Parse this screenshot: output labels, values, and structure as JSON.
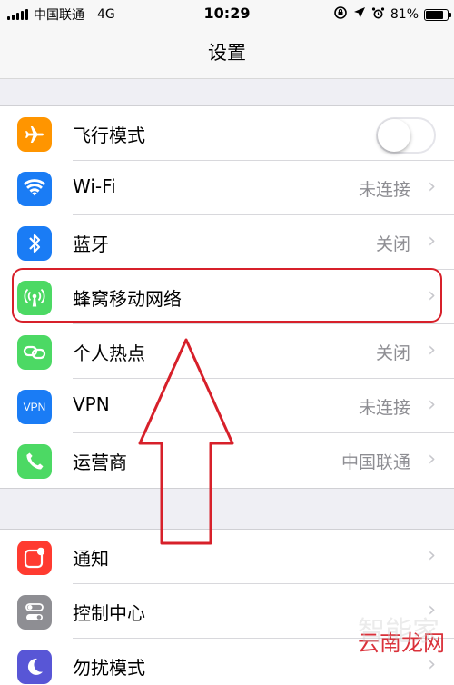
{
  "status_bar": {
    "carrier": "中国联通",
    "network": "4G",
    "time": "10:29",
    "battery": "81%",
    "battery_level": 0.81
  },
  "nav": {
    "title": "设置"
  },
  "group1": {
    "items": [
      {
        "label": "飞行模式",
        "icon": "airplane-icon",
        "color": "#ff9500",
        "toggle_on": false
      },
      {
        "label": "Wi-Fi",
        "icon": "wifi-icon",
        "color": "#1a7cf5",
        "value": "未连接"
      },
      {
        "label": "蓝牙",
        "icon": "bluetooth-icon",
        "color": "#1a7cf5",
        "value": "关闭"
      },
      {
        "label": "蜂窝移动网络",
        "icon": "cellular-antenna-icon",
        "color": "#4cd964",
        "value": ""
      },
      {
        "label": "个人热点",
        "icon": "hotspot-icon",
        "color": "#4cd964",
        "value": "关闭"
      },
      {
        "label": "VPN",
        "icon": "vpn-icon",
        "color": "#1a7cf5",
        "value": "未连接",
        "icon_text": "VPN"
      },
      {
        "label": "运营商",
        "icon": "phone-icon",
        "color": "#4cd964",
        "value": "中国联通"
      }
    ]
  },
  "group2": {
    "items": [
      {
        "label": "通知",
        "icon": "notifications-icon",
        "color": "#ff3b30"
      },
      {
        "label": "控制中心",
        "icon": "control-center-icon",
        "color": "#8e8e93"
      },
      {
        "label": "勿扰模式",
        "icon": "moon-icon",
        "color": "#5856d6"
      }
    ]
  },
  "watermark": {
    "text": "云南龙网",
    "faint_text": "智能家"
  }
}
